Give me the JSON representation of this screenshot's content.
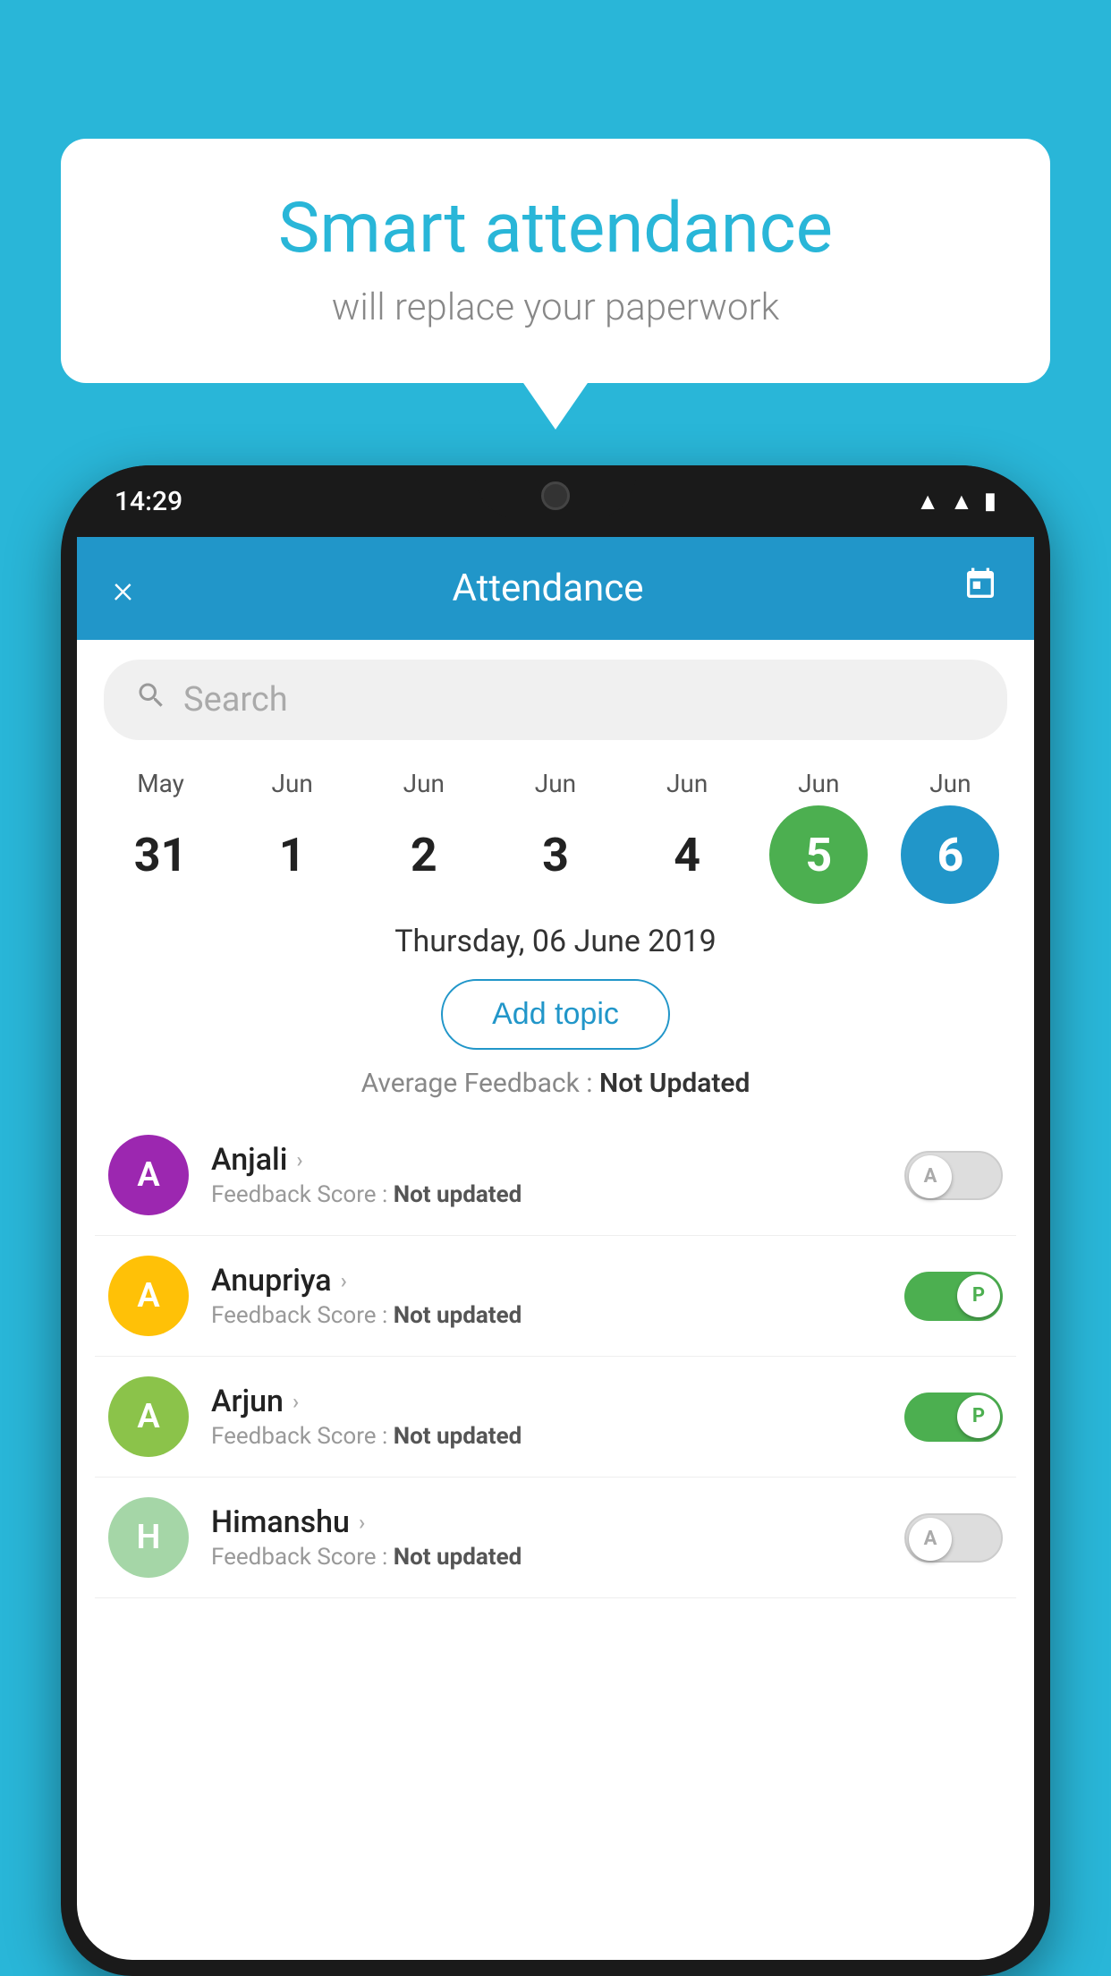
{
  "background_color": "#29b6d8",
  "bubble": {
    "title": "Smart attendance",
    "subtitle": "will replace your paperwork"
  },
  "phone": {
    "status_time": "14:29",
    "header": {
      "title": "Attendance",
      "close_label": "×",
      "calendar_icon": "📅"
    },
    "search": {
      "placeholder": "Search"
    },
    "calendar": {
      "days": [
        {
          "month": "May",
          "date": "31",
          "state": "normal"
        },
        {
          "month": "Jun",
          "date": "1",
          "state": "normal"
        },
        {
          "month": "Jun",
          "date": "2",
          "state": "normal"
        },
        {
          "month": "Jun",
          "date": "3",
          "state": "normal"
        },
        {
          "month": "Jun",
          "date": "4",
          "state": "normal"
        },
        {
          "month": "Jun",
          "date": "5",
          "state": "today"
        },
        {
          "month": "Jun",
          "date": "6",
          "state": "selected"
        }
      ]
    },
    "selected_date": "Thursday, 06 June 2019",
    "add_topic_label": "Add topic",
    "avg_feedback_label": "Average Feedback :",
    "avg_feedback_value": "Not Updated",
    "students": [
      {
        "name": "Anjali",
        "initial": "A",
        "avatar_color": "#9c27b0",
        "feedback_label": "Feedback Score :",
        "feedback_value": "Not updated",
        "toggle_state": "off",
        "toggle_label": "A"
      },
      {
        "name": "Anupriya",
        "initial": "A",
        "avatar_color": "#ffc107",
        "feedback_label": "Feedback Score :",
        "feedback_value": "Not updated",
        "toggle_state": "on",
        "toggle_label": "P"
      },
      {
        "name": "Arjun",
        "initial": "A",
        "avatar_color": "#8bc34a",
        "feedback_label": "Feedback Score :",
        "feedback_value": "Not updated",
        "toggle_state": "on",
        "toggle_label": "P"
      },
      {
        "name": "Himanshu",
        "initial": "H",
        "avatar_color": "#a5d6a7",
        "feedback_label": "Feedback Score :",
        "feedback_value": "Not updated",
        "toggle_state": "off",
        "toggle_label": "A"
      }
    ]
  }
}
